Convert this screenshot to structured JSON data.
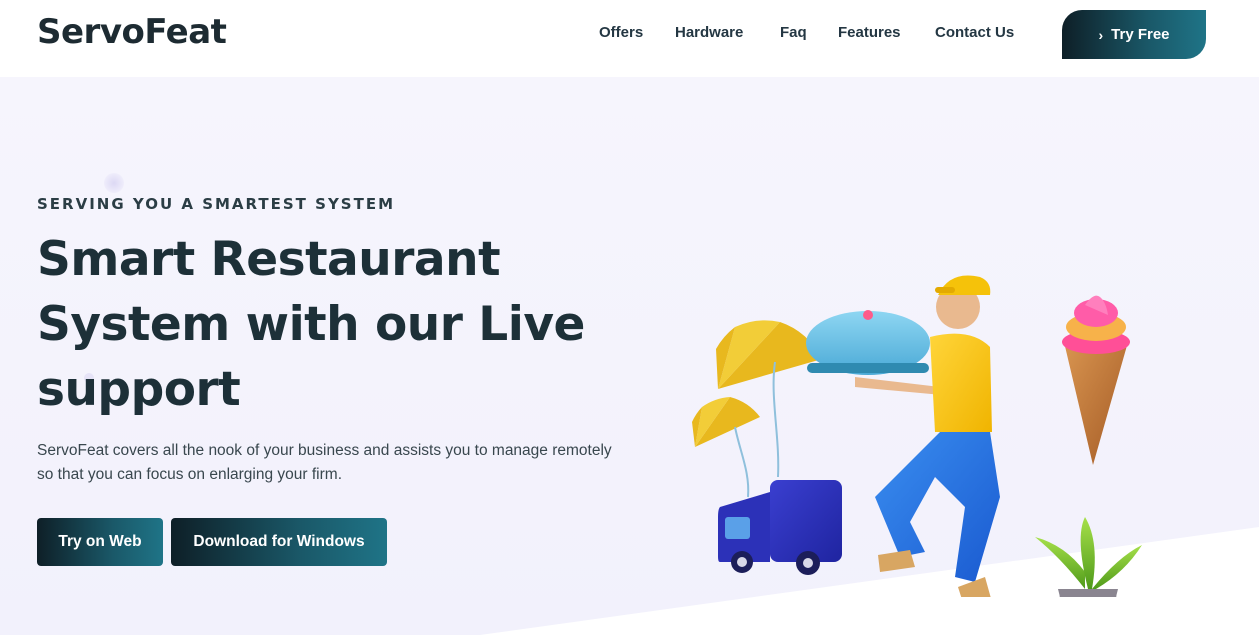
{
  "header": {
    "logo": "ServoFeat",
    "nav": [
      "Offers",
      "Hardware",
      "Faq",
      "Features",
      "Contact Us"
    ],
    "cta_label": "Try Free",
    "cta_icon": "chevron-right-icon"
  },
  "hero": {
    "eyebrow": "SERVING YOU A SMARTEST SYSTEM",
    "headline_line1": "Smart Restaurant",
    "headline_line2": "System with our Live",
    "headline_line3": "support",
    "description": "ServoFeat covers all the nook of your business and assists you to manage remotely so that you can focus on enlarging your firm.",
    "buttons": {
      "web": "Try on Web",
      "windows": "Download for Windows"
    }
  },
  "colors": {
    "brand_dark": "#0e1f27",
    "brand_teal": "#1f7487",
    "hero_bg": "#f4f3fd",
    "text_dark": "#1d3038"
  }
}
